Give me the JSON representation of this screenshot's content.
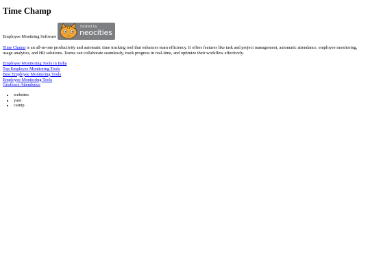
{
  "page": {
    "title": "Time Champ",
    "tagline": "Employee Monitring Software",
    "badge": {
      "icon": "neocities-cat-icon",
      "hosted_text": "hosted by",
      "brand_text": "neocities",
      "bg_color": "#7d7e81",
      "cat_color": "#f0a830"
    },
    "intro": {
      "link_text": "Time Champ",
      "text": " is an all-in-one productivity and automatic time tracking tool that enhances team efficiency. It offers features like task and project management, automatic attendance, employee monitoring, usage analytics, and HR solutions. Teams can collaborate seamlessly, track progress in real-time, and optimize their workflow effectively."
    },
    "links": [
      "Employee Monitoring Tools in India",
      "Top Employee Monitoring Tools",
      "Best Employee Monitoring Tools",
      "Employee Monitoring Tools",
      "Geofence Attendence"
    ],
    "list": [
      "websites",
      "yarn",
      "catnip"
    ],
    "link_color": "#0000ee"
  }
}
